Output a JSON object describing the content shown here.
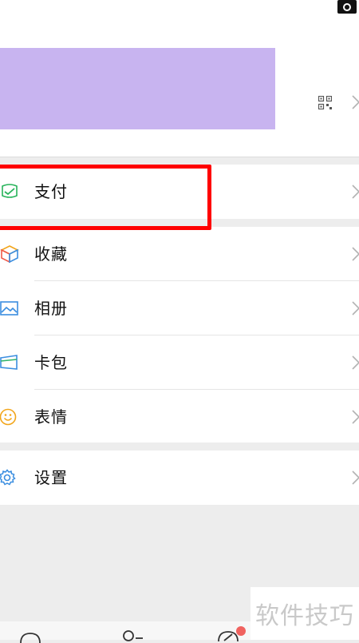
{
  "menu": {
    "pay": {
      "label": "支付",
      "icon": "wallet-check-icon"
    },
    "items": [
      {
        "label": "收藏",
        "icon": "cube-icon"
      },
      {
        "label": "相册",
        "icon": "photo-icon"
      },
      {
        "label": "卡包",
        "icon": "card-icon"
      },
      {
        "label": "表情",
        "icon": "smiley-icon"
      }
    ],
    "settings": {
      "label": "设置",
      "icon": "gear-icon"
    }
  },
  "colors": {
    "highlight": "#ff0000",
    "redaction": "#c8b4f0",
    "badge": "#f0625f"
  },
  "watermark": {
    "text": "软件技巧"
  }
}
